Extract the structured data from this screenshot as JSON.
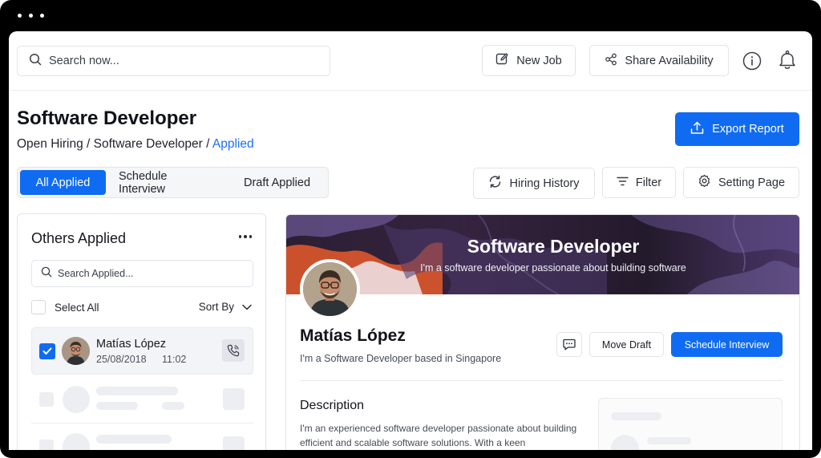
{
  "topbar": {
    "search_placeholder": "Search now...",
    "new_job": "New Job",
    "share_availability": "Share Availability"
  },
  "header": {
    "title": "Software Developer",
    "breadcrumb": {
      "part1": "Open Hiring",
      "sep1": "/",
      "part2": "Software Developer",
      "sep2": "/",
      "current": "Applied"
    },
    "export": "Export Report"
  },
  "tabs": [
    "All Applied",
    "Schedule Interview",
    "Draft Applied"
  ],
  "toolbar": {
    "hiring_history": "Hiring History",
    "filter": "Filter",
    "setting_page": "Setting Page"
  },
  "left_panel": {
    "title": "Others Applied",
    "search_placeholder": "Search Applied...",
    "select_all": "Select All",
    "sort_by": "Sort By",
    "applicant": {
      "name": "Matías López",
      "date": "25/08/2018",
      "time": "11:02",
      "checked": true
    }
  },
  "profile": {
    "banner_title": "Software Developer",
    "banner_subtitle": "I'm a software developer passionate about building software",
    "name": "Matías López",
    "tagline": "I'm a Software Developer based in Singapore",
    "move_draft": "Move Draft",
    "schedule_interview": "Schedule Interview",
    "description_title": "Description",
    "description_text": "I'm an experienced software developer passionate about building efficient and scalable software solutions. With a keen"
  },
  "colors": {
    "accent": "#0f6bf2",
    "link": "#1a6ff5"
  }
}
